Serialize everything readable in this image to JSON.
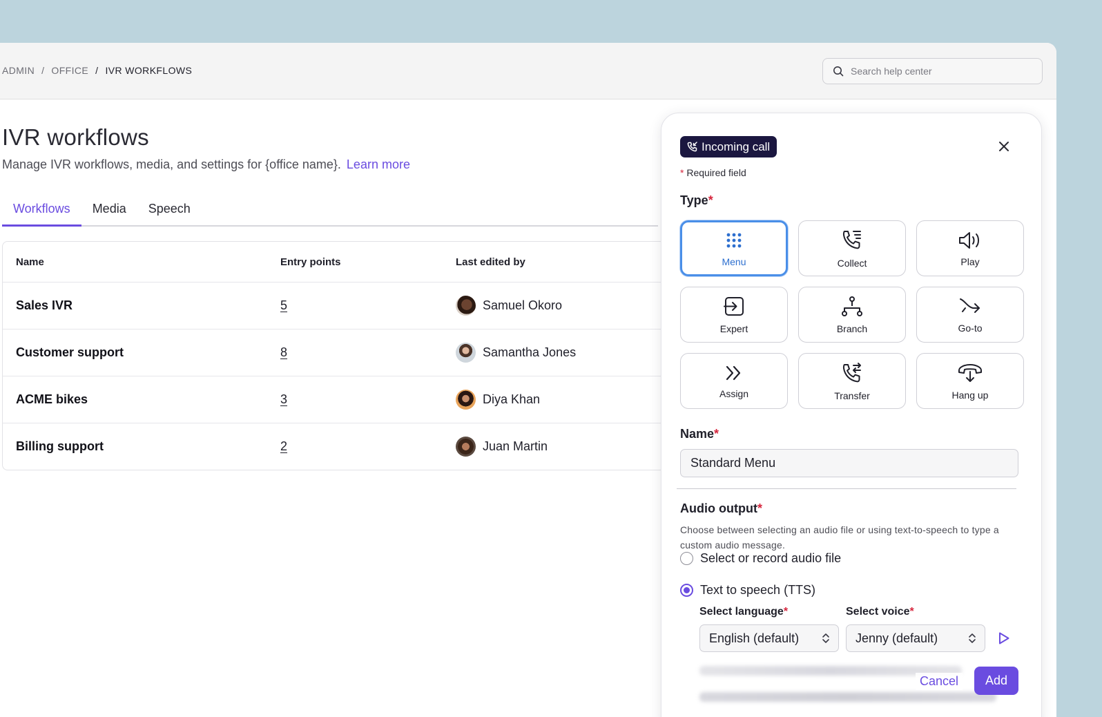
{
  "breadcrumb": {
    "items": [
      "ADMIN",
      "OFFICE",
      "IVR WORKFLOWS"
    ],
    "separator": "/"
  },
  "search": {
    "placeholder": "Search help center"
  },
  "page": {
    "title": "IVR workflows",
    "subtitle": "Manage IVR workflows, media, and settings for {office name}.",
    "learn_more": "Learn more"
  },
  "tabs": [
    {
      "label": "Workflows",
      "active": true
    },
    {
      "label": "Media",
      "active": false
    },
    {
      "label": "Speech",
      "active": false
    }
  ],
  "table": {
    "headers": [
      "Name",
      "Entry points",
      "Last edited by"
    ],
    "rows": [
      {
        "name": "Sales IVR",
        "entry_points": "5",
        "editor": "Samuel Okoro"
      },
      {
        "name": "Customer support",
        "entry_points": "8",
        "editor": "Samantha Jones"
      },
      {
        "name": "ACME bikes",
        "entry_points": "3",
        "editor": "Diya Khan"
      },
      {
        "name": "Billing support",
        "entry_points": "2",
        "editor": "Juan Martin"
      }
    ]
  },
  "panel": {
    "badge": "Incoming call",
    "required_note": "Required field",
    "type_label": "Type",
    "types": [
      {
        "label": "Menu",
        "icon": "dialpad-icon",
        "selected": true
      },
      {
        "label": "Collect",
        "icon": "phone-list-icon",
        "selected": false
      },
      {
        "label": "Play",
        "icon": "speaker-icon",
        "selected": false
      },
      {
        "label": "Expert",
        "icon": "enter-box-icon",
        "selected": false
      },
      {
        "label": "Branch",
        "icon": "branch-icon",
        "selected": false
      },
      {
        "label": "Go-to",
        "icon": "goto-arrow-icon",
        "selected": false
      },
      {
        "label": "Assign",
        "icon": "double-chevron-icon",
        "selected": false
      },
      {
        "label": "Transfer",
        "icon": "phone-transfer-icon",
        "selected": false
      },
      {
        "label": "Hang up",
        "icon": "hang-up-icon",
        "selected": false
      }
    ],
    "name_label": "Name",
    "name_value": "Standard Menu",
    "audio_label": "Audio output",
    "audio_desc": "Choose between selecting an audio file or using text-to-speech to type a custom audio message.",
    "radio_file": "Select or record audio file",
    "radio_tts": "Text to speech (TTS)",
    "language_label": "Select language",
    "language_value": "English (default)",
    "voice_label": "Select voice",
    "voice_value": "Jenny (default)",
    "cancel": "Cancel",
    "add": "Add"
  },
  "colors": {
    "accent": "#6a4ce0",
    "selected_border": "#4a8fe8",
    "badge_bg": "#1b1740",
    "required": "#d6263d"
  }
}
